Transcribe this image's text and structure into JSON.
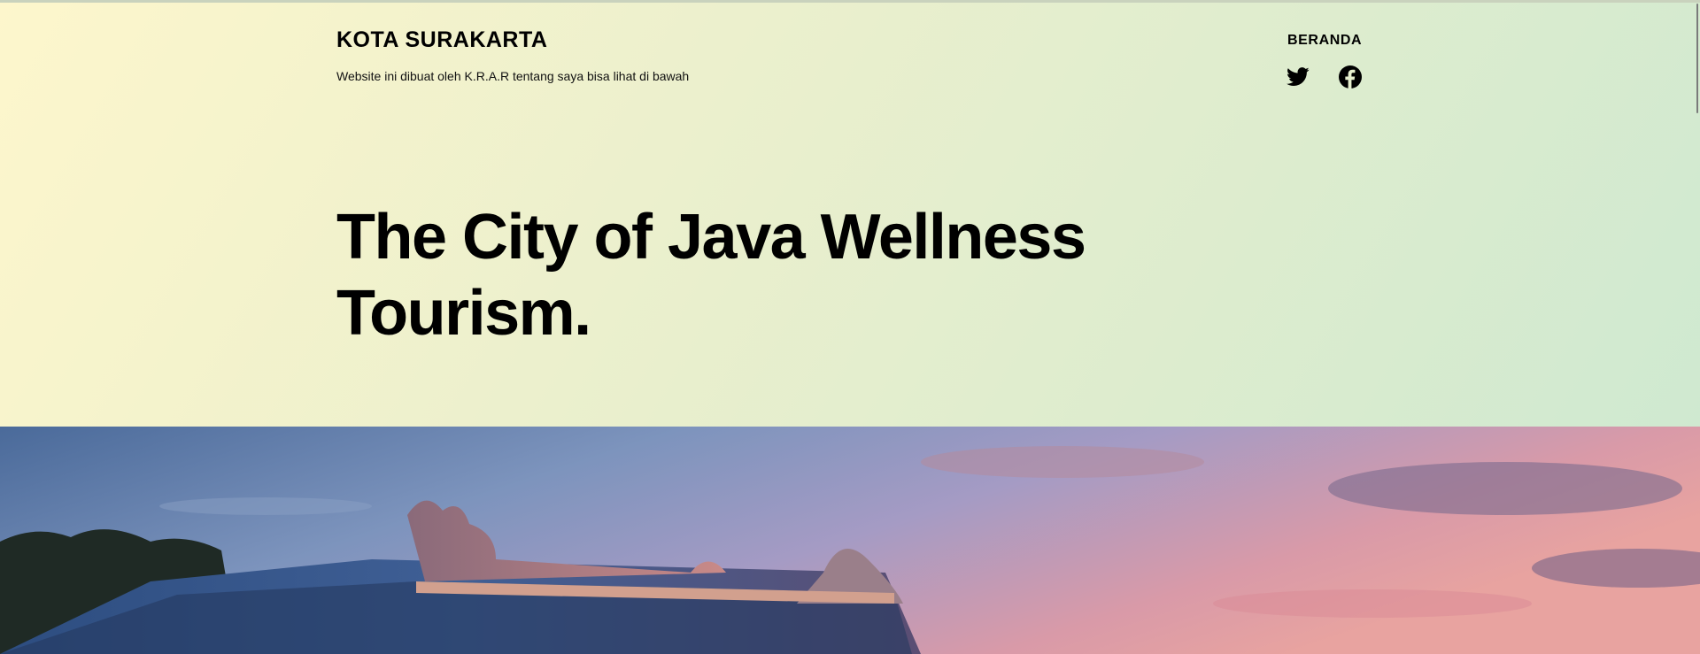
{
  "header": {
    "site_title": "KOTA SURAKARTA",
    "tagline": "Website ini dibuat oleh K.R.A.R tentang saya bisa lihat di bawah",
    "nav": [
      {
        "label": "BERANDA"
      }
    ],
    "social": [
      {
        "icon": "twitter-icon"
      },
      {
        "icon": "facebook-icon"
      }
    ]
  },
  "hero": {
    "title": "The City of Java Wellness Tourism.",
    "image": {
      "subject": "temple-roof-at-sunset"
    }
  },
  "colors": {
    "gradient_start": "#fdf6cc",
    "gradient_end": "#cfe9d0",
    "text": "#000000"
  }
}
